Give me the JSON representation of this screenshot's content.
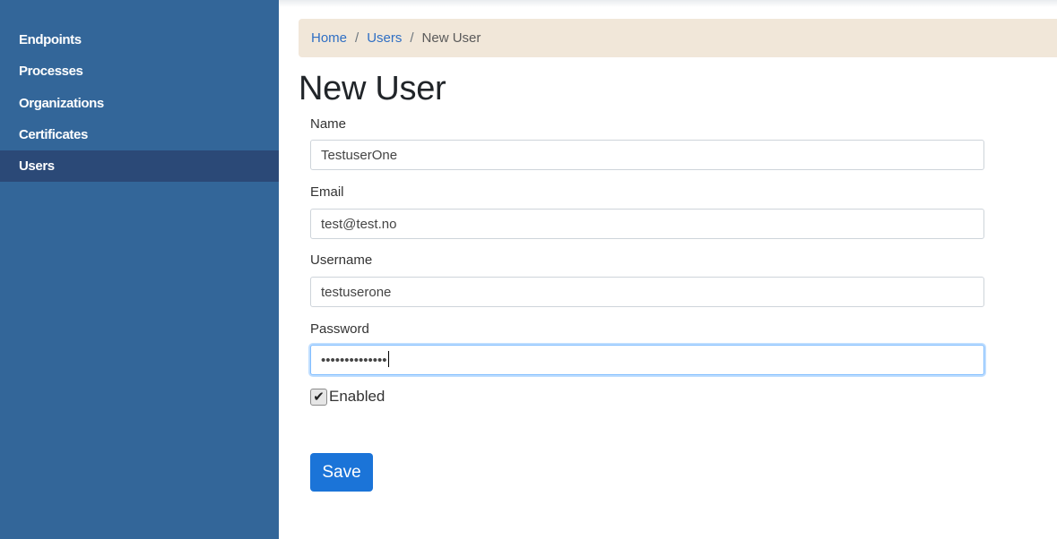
{
  "sidebar": {
    "items": [
      {
        "label": "Endpoints",
        "active": false
      },
      {
        "label": "Processes",
        "active": false
      },
      {
        "label": "Organizations",
        "active": false
      },
      {
        "label": "Certificates",
        "active": false
      },
      {
        "label": "Users",
        "active": true
      }
    ]
  },
  "breadcrumb": {
    "home": "Home",
    "users": "Users",
    "current": "New User",
    "separator": "/"
  },
  "page": {
    "title": "New User"
  },
  "form": {
    "name": {
      "label": "Name",
      "value": "TestuserOne"
    },
    "email": {
      "label": "Email",
      "value": "test@test.no"
    },
    "username": {
      "label": "Username",
      "value": "testuserone"
    },
    "password": {
      "label": "Password",
      "value": "testuserone123"
    },
    "enabled": {
      "label": "Enabled",
      "checked": true,
      "check_glyph": "✔"
    },
    "save_label": "Save"
  },
  "colors": {
    "sidebar": "#336699",
    "sidebar_active": "#2b4977",
    "breadcrumb_bg": "#f1e7d9",
    "link": "#2f6fc4",
    "primary_button": "#1b74d8"
  }
}
